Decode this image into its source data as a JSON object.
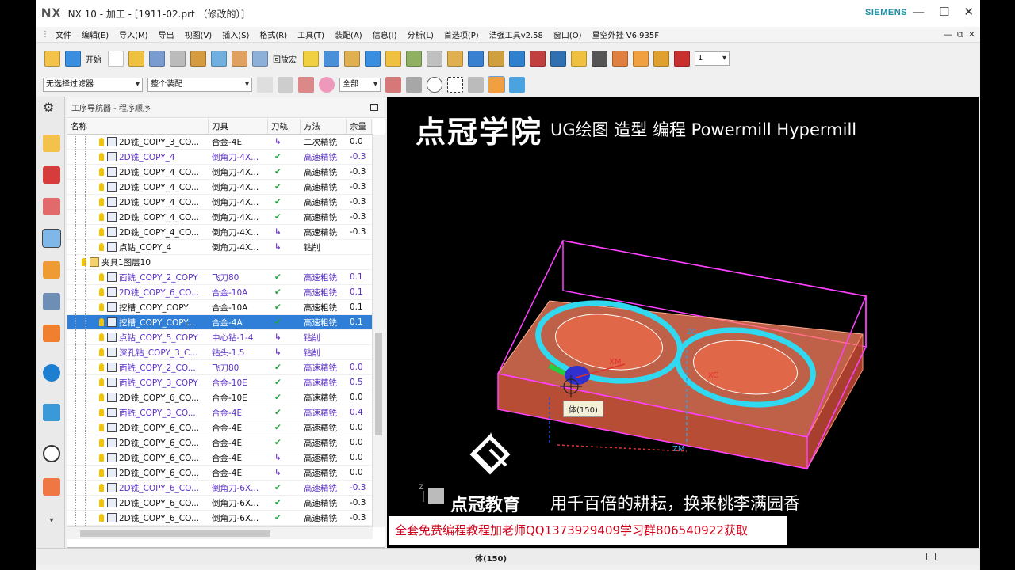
{
  "titlebar": {
    "logo": "NX",
    "title": "NX 10 - 加工 - [1911-02.prt （修改的）]",
    "brand": "SIEMENS",
    "minimize": "—",
    "maximize": "☐",
    "close": "✕"
  },
  "menu": {
    "items": [
      "文件",
      "编辑(E)",
      "导入(M)",
      "导出",
      "视图(V)",
      "插入(S)",
      "格式(R)",
      "工具(T)",
      "装配(A)",
      "信息(I)",
      "分析(L)",
      "首选项(P)",
      "浩强工具v2.58",
      "窗口(O)",
      "星空外挂 V6.935F"
    ],
    "right_buttons": [
      "—",
      "⧉",
      "✕"
    ]
  },
  "toolbar": {
    "start_label": "开始",
    "macro_label": "回放宏",
    "layer_value": "1"
  },
  "filters": {
    "selection_filter": "无选择过滤器",
    "assembly_scope": "整个装配",
    "all_option": "全部"
  },
  "navigator": {
    "title": "工序导航器 - 程序顺序",
    "columns": [
      "名称",
      "刀具",
      "刀轨",
      "方法",
      "余量"
    ],
    "rows": [
      {
        "name": "2D铣_COPY_3_CO...",
        "tool": "合金-4E",
        "path": "↳",
        "method": "二次精铣",
        "stock": "0.0",
        "style": "normal",
        "status": "redo"
      },
      {
        "name": "2D铣_COPY_4",
        "tool": "倒角刀-4X...",
        "path": "✔",
        "method": "高速精铣",
        "stock": "-0.3",
        "style": "purple",
        "status": "ok"
      },
      {
        "name": "2D铣_COPY_4_CO...",
        "tool": "倒角刀-4X...",
        "path": "✔",
        "method": "高速精铣",
        "stock": "-0.3",
        "style": "normal",
        "status": "ok"
      },
      {
        "name": "2D铣_COPY_4_CO...",
        "tool": "倒角刀-4X...",
        "path": "✔",
        "method": "高速精铣",
        "stock": "-0.3",
        "style": "normal",
        "status": "ok"
      },
      {
        "name": "2D铣_COPY_4_CO...",
        "tool": "倒角刀-4X...",
        "path": "✔",
        "method": "高速精铣",
        "stock": "-0.3",
        "style": "normal",
        "status": "ok"
      },
      {
        "name": "2D铣_COPY_4_CO...",
        "tool": "倒角刀-4X...",
        "path": "✔",
        "method": "高速精铣",
        "stock": "-0.3",
        "style": "normal",
        "status": "ok"
      },
      {
        "name": "2D铣_COPY_4_CO...",
        "tool": "倒角刀-4X...",
        "path": "↳",
        "method": "高速精铣",
        "stock": "-0.3",
        "style": "normal",
        "status": "redo"
      },
      {
        "name": "点钻_COPY_4",
        "tool": "倒角刀-4X...",
        "path": "↳",
        "method": "钻削",
        "stock": "",
        "style": "normal",
        "status": "redo"
      },
      {
        "name": "夹具1图层10",
        "tool": "",
        "path": "",
        "method": "",
        "stock": "",
        "style": "group",
        "status": ""
      },
      {
        "name": "面铣_COPY_2_COPY",
        "tool": "飞刀80",
        "path": "✔",
        "method": "高速粗铣",
        "stock": "0.1",
        "style": "purple",
        "status": "ok"
      },
      {
        "name": "2D铣_COPY_6_CO...",
        "tool": "合金-10A",
        "path": "✔",
        "method": "高速粗铣",
        "stock": "0.1",
        "style": "purple",
        "status": "ok"
      },
      {
        "name": "挖槽_COPY_COPY",
        "tool": "合金-10A",
        "path": "✔",
        "method": "高速粗铣",
        "stock": "0.1",
        "style": "normal",
        "status": "ok"
      },
      {
        "name": "挖槽_COPY_COPY...",
        "tool": "合金-4A",
        "path": "✔",
        "method": "高速粗铣",
        "stock": "0.1",
        "style": "selected",
        "status": "ok"
      },
      {
        "name": "点钻_COPY_5_COPY",
        "tool": "中心钻-1-4",
        "path": "↳",
        "method": "钻削",
        "stock": "",
        "style": "purple",
        "status": "redo"
      },
      {
        "name": "深孔钻_COPY_3_C...",
        "tool": "钻头-1.5",
        "path": "↳",
        "method": "钻削",
        "stock": "",
        "style": "purple",
        "status": "redo"
      },
      {
        "name": "面铣_COPY_2_CO...",
        "tool": "飞刀80",
        "path": "✔",
        "method": "高速精铣",
        "stock": "0.0",
        "style": "purple",
        "status": "ok"
      },
      {
        "name": "面铣_COPY_3_COPY",
        "tool": "合金-10E",
        "path": "✔",
        "method": "高速精铣",
        "stock": "0.5",
        "style": "purple",
        "status": "ok"
      },
      {
        "name": "2D铣_COPY_6_CO...",
        "tool": "合金-10E",
        "path": "✔",
        "method": "高速精铣",
        "stock": "0.0",
        "style": "normal",
        "status": "ok"
      },
      {
        "name": "面铣_COPY_3_CO...",
        "tool": "合金-4E",
        "path": "✔",
        "method": "高速精铣",
        "stock": "0.4",
        "style": "purple",
        "status": "ok"
      },
      {
        "name": "2D铣_COPY_6_CO...",
        "tool": "合金-4E",
        "path": "✔",
        "method": "高速精铣",
        "stock": "0.0",
        "style": "normal",
        "status": "ok"
      },
      {
        "name": "2D铣_COPY_6_CO...",
        "tool": "合金-4E",
        "path": "✔",
        "method": "高速精铣",
        "stock": "0.0",
        "style": "normal",
        "status": "ok"
      },
      {
        "name": "2D铣_COPY_6_CO...",
        "tool": "合金-4E",
        "path": "↳",
        "method": "高速精铣",
        "stock": "0.0",
        "style": "normal",
        "status": "redo"
      },
      {
        "name": "2D铣_COPY_6_CO...",
        "tool": "合金-4E",
        "path": "↳",
        "method": "高速精铣",
        "stock": "0.0",
        "style": "normal",
        "status": "redo"
      },
      {
        "name": "2D铣_COPY_6_CO...",
        "tool": "倒角刀-6X...",
        "path": "✔",
        "method": "高速精铣",
        "stock": "-0.3",
        "style": "purple",
        "status": "ok"
      },
      {
        "name": "2D铣_COPY_6_CO...",
        "tool": "倒角刀-6X...",
        "path": "✔",
        "method": "高速精铣",
        "stock": "-0.3",
        "style": "normal",
        "status": "ok"
      },
      {
        "name": "2D铣_COPY_6_CO...",
        "tool": "倒角刀-6X...",
        "path": "✔",
        "method": "高速精铣",
        "stock": "-0.3",
        "style": "normal",
        "status": "ok"
      }
    ]
  },
  "viewport": {
    "heading_cn": "点冠学院",
    "heading_en": "UG绘图 造型 编程 Powermill Hypermill",
    "brand": "点冠教育",
    "slogan": "用千百倍的耕耘，换来桃李满园香",
    "promo": "全套免费编程教程加老师QQ1373929409学习群806540922获取",
    "tooltip": "体(150)",
    "axis_labels": [
      "XM",
      "XC",
      "ZM",
      "ZC",
      "Z"
    ]
  },
  "status": {
    "text": "体(150)"
  },
  "colors": {
    "accent": "#2f7fd8",
    "siemens": "#1a8fa8",
    "promo_text": "#d0021b",
    "model_fill": "#ff8060",
    "model_edges": "#ff40ff",
    "toolpath": "#30d8f0"
  }
}
